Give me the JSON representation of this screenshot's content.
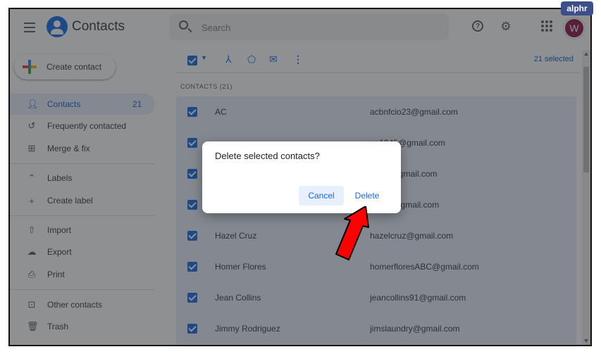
{
  "header": {
    "app_title": "Contacts",
    "search_placeholder": "Search",
    "avatar_letter": "W"
  },
  "sidebar": {
    "create_label": "Create contact",
    "items": [
      {
        "label": "Contacts",
        "count": "21",
        "icon": "person-icon",
        "active": true
      },
      {
        "label": "Frequently contacted",
        "count": "",
        "icon": "history-icon"
      },
      {
        "label": "Merge & fix",
        "count": "",
        "icon": "merge-icon"
      },
      {
        "label": "Labels",
        "count": "",
        "icon": "chevron-up-icon"
      },
      {
        "label": "Create label",
        "count": "",
        "icon": "plus-icon"
      },
      {
        "label": "Import",
        "count": "",
        "icon": "upload-icon"
      },
      {
        "label": "Export",
        "count": "",
        "icon": "cloud-download-icon"
      },
      {
        "label": "Print",
        "count": "",
        "icon": "printer-icon"
      },
      {
        "label": "Other contacts",
        "count": "",
        "icon": "other-contacts-icon"
      },
      {
        "label": "Trash",
        "count": "",
        "icon": "trash-icon"
      }
    ]
  },
  "toolbar": {
    "selected_count": "21 selected"
  },
  "list": {
    "section_title": "CONTACTS (21)",
    "rows": [
      {
        "name": "AC",
        "email": "acbnfcio23@gmail.com"
      },
      {
        "name": "",
        "email": "ue1945@gmail.com"
      },
      {
        "name": "",
        "email": "cia23@gmail.com"
      },
      {
        "name": "",
        "email": "olly34@gmail.com"
      },
      {
        "name": "Hazel Cruz",
        "email": "hazelcruz@gmail.com"
      },
      {
        "name": "Homer Flores",
        "email": "homerfloresABC@gmail.com"
      },
      {
        "name": "Jean Collins",
        "email": "jeancollins91@gmail.com"
      },
      {
        "name": "Jimmy Rodriguez",
        "email": "jimslaundry@gmail.com"
      }
    ]
  },
  "dialog": {
    "title": "Delete selected contacts?",
    "cancel_label": "Cancel",
    "delete_label": "Delete"
  },
  "watermark": "alphr",
  "colors": {
    "accent": "#1a73e8",
    "active_bg": "#e8f0fe",
    "arrow": "#ff0000",
    "avatar": "#8e1f52"
  }
}
